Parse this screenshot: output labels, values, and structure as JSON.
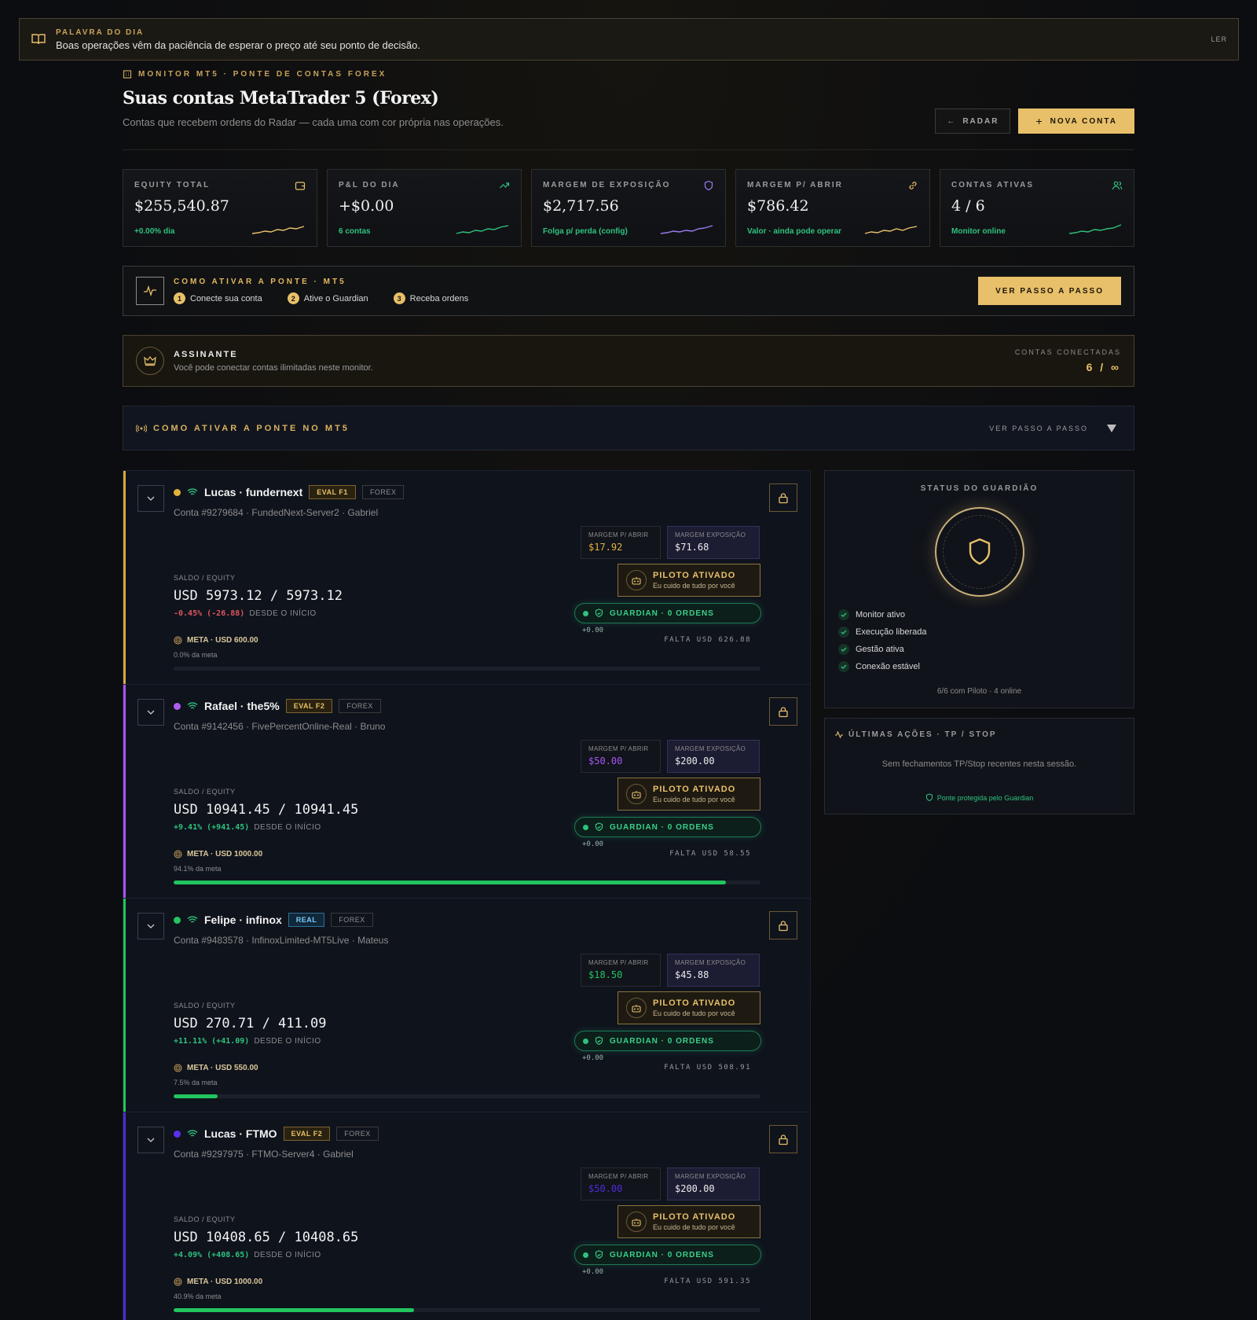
{
  "banner": {
    "kicker": "PALAVRA DO DIA",
    "message": "Boas operações vêm da paciência de esperar o preço até seu ponto de decisão.",
    "read": "LER"
  },
  "header": {
    "kicker": "MONITOR MT5 · PONTE DE CONTAS FOREX",
    "title": "Suas contas MetaTrader 5 (Forex)",
    "subtitle": "Contas que recebem ordens do Radar — cada uma com cor própria nas operações.",
    "radar_btn": "RADAR",
    "new_btn": "NOVA CONTA"
  },
  "stats": [
    {
      "label": "EQUITY TOTAL",
      "value": "$255,540.87",
      "foot": "+0.00% dia",
      "icon": "wallet-icon",
      "spark_color": "#e8c06a"
    },
    {
      "label": "P&L DO DIA",
      "value": "+$0.00",
      "foot": "6 contas",
      "icon": "trending-up-icon",
      "spark_color": "#2ec27e"
    },
    {
      "label": "MARGEM DE EXPOSIÇÃO",
      "value": "$2,717.56",
      "foot": "Folga p/ perda (config)",
      "icon": "shield-icon",
      "spark_color": "#9a7df0"
    },
    {
      "label": "MARGEM P/ ABRIR",
      "value": "$786.42",
      "foot": "Valor · ainda pode operar",
      "icon": "link-icon",
      "spark_color": "#e8c06a"
    },
    {
      "label": "CONTAS ATIVAS",
      "value": "4 / 6",
      "foot": "Monitor online",
      "icon": "users-icon",
      "spark_color": "#2ec27e"
    }
  ],
  "howto": {
    "title": "COMO ATIVAR A PONTE · MT5",
    "steps": [
      {
        "n": "1",
        "label": "Conecte sua conta"
      },
      {
        "n": "2",
        "label": "Ative o Guardian"
      },
      {
        "n": "3",
        "label": "Receba ordens"
      }
    ],
    "button": "VER PASSO A PASSO"
  },
  "subscriber": {
    "title": "ASSINANTE",
    "desc": "Você pode conectar contas ilimitadas neste monitor.",
    "right_label": "CONTAS CONECTADAS",
    "right_value": "6 / ∞"
  },
  "accordion": {
    "title": "COMO ATIVAR A PONTE NO MT5",
    "action": "VER PASSO A PASSO"
  },
  "accounts": [
    {
      "color": "#d4a83a",
      "dot": "#e3b23c",
      "name": "Lucas · fundernext",
      "tag": "EVAL F1",
      "tag_type": "eval",
      "market": "FOREX",
      "meta": "Conta #9279684 · FundedNext-Server2 · Gabriel",
      "m_open_label": "MARGEM P/ ABRIR",
      "m_open": "$17.92",
      "m_open_color": "#e3b23c",
      "m_exp_label": "MARGEM EXPOSIÇÃO",
      "m_exp": "$71.68",
      "pilot": "PILOTO ATIVADO",
      "pilot_sub": "Eu cuido de tudo por você",
      "guardian": "GUARDIAN · 0 ORDENS",
      "pl": "+0.00",
      "saldo_label": "SALDO / EQUITY",
      "saldo": "USD 5973.12 / 5973.12",
      "pct": "-0.45% (-26.88)",
      "pct_color": "#e05560",
      "since": "DESDE O INÍCIO",
      "goal": "META · USD 600.00",
      "goal_pct": "0.0% da meta",
      "progress": 0.0,
      "falta": "FALTA USD 626.88"
    },
    {
      "color": "#a855f7",
      "dot": "#b05cf0",
      "name": "Rafael · the5%",
      "tag": "EVAL F2",
      "tag_type": "eval",
      "market": "FOREX",
      "meta": "Conta #9142456 · FivePercentOnline-Real · Bruno",
      "m_open_label": "MARGEM P/ ABRIR",
      "m_open": "$50.00",
      "m_open_color": "#a855f7",
      "m_exp_label": "MARGEM EXPOSIÇÃO",
      "m_exp": "$200.00",
      "pilot": "PILOTO ATIVADO",
      "pilot_sub": "Eu cuido de tudo por você",
      "guardian": "GUARDIAN · 0 ORDENS",
      "pl": "+0.00",
      "saldo_label": "SALDO / EQUITY",
      "saldo": "USD 10941.45 / 10941.45",
      "pct": "+9.41% (+941.45)",
      "pct_color": "#2ec27e",
      "since": "DESDE O INÍCIO",
      "goal": "META · USD 1000.00",
      "goal_pct": "94.1% da meta",
      "progress": 0.941,
      "falta": "FALTA USD 58.55"
    },
    {
      "color": "#22c55e",
      "dot": "#22c55e",
      "name": "Felipe · infinox",
      "tag": "REAL",
      "tag_type": "real",
      "market": "FOREX",
      "meta": "Conta #9483578 · InfinoxLimited-MT5Live · Mateus",
      "m_open_label": "MARGEM P/ ABRIR",
      "m_open": "$18.50",
      "m_open_color": "#22c55e",
      "m_exp_label": "MARGEM EXPOSIÇÃO",
      "m_exp": "$45.88",
      "pilot": "PILOTO ATIVADO",
      "pilot_sub": "Eu cuido de tudo por você",
      "guardian": "GUARDIAN · 0 ORDENS",
      "pl": "+0.00",
      "saldo_label": "SALDO / EQUITY",
      "saldo": "USD 270.71 / 411.09",
      "pct": "+11.11% (+41.09)",
      "pct_color": "#2ec27e",
      "since": "DESDE O INÍCIO",
      "goal": "META · USD 550.00",
      "goal_pct": "7.5% da meta",
      "progress": 0.075,
      "falta": "FALTA USD 508.91"
    },
    {
      "color": "#4f2bd9",
      "dot": "#5b2ff0",
      "name": "Lucas · FTMO",
      "tag": "EVAL F2",
      "tag_type": "eval",
      "market": "FOREX",
      "meta": "Conta #9297975 · FTMO-Server4 · Gabriel",
      "m_open_label": "MARGEM P/ ABRIR",
      "m_open": "$50.00",
      "m_open_color": "#4f2bd9",
      "m_exp_label": "MARGEM EXPOSIÇÃO",
      "m_exp": "$200.00",
      "pilot": "PILOTO ATIVADO",
      "pilot_sub": "Eu cuido de tudo por você",
      "guardian": "GUARDIAN · 0 ORDENS",
      "pl": "+0.00",
      "saldo_label": "SALDO / EQUITY",
      "saldo": "USD 10408.65 / 10408.65",
      "pct": "+4.09% (+408.65)",
      "pct_color": "#2ec27e",
      "since": "DESDE O INÍCIO",
      "goal": "META · USD 1000.00",
      "goal_pct": "40.9% da meta",
      "progress": 0.409,
      "falta": "FALTA USD 591.35"
    }
  ],
  "guardian_panel": {
    "title": "STATUS DO GUARDIÃO",
    "checks": [
      "Monitor ativo",
      "Execução liberada",
      "Gestão ativa",
      "Conexão estável"
    ],
    "footer": "6/6 com Piloto · 4 online"
  },
  "actions_panel": {
    "title": "ÚLTIMAS AÇÕES · TP / STOP",
    "empty": "Sem fechamentos TP/Stop recentes nesta sessão.",
    "protected": "Ponte protegida pelo Guardian"
  }
}
